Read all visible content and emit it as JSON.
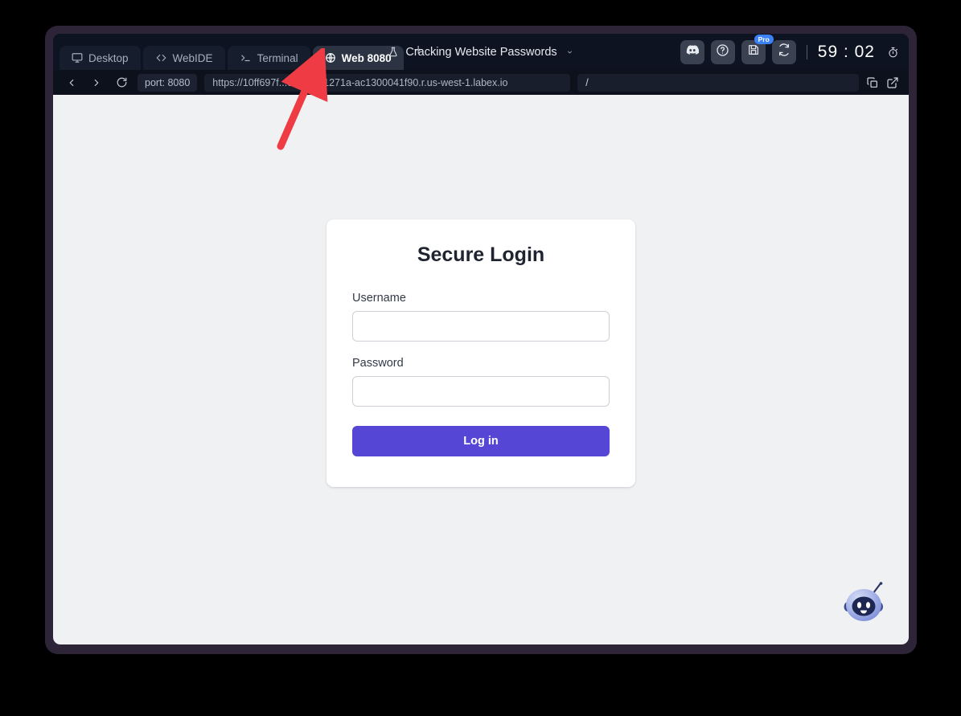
{
  "window": {
    "tabs": [
      {
        "label": "Desktop",
        "icon": "monitor-icon",
        "active": false
      },
      {
        "label": "WebIDE",
        "icon": "code-brackets-icon",
        "active": false
      },
      {
        "label": "Terminal",
        "icon": "terminal-prompt-icon",
        "active": false
      },
      {
        "label": "Web 8080",
        "icon": "globe-icon",
        "active": true
      }
    ],
    "add_tab_label": "+",
    "lab_title": "Cracking Website Passwords",
    "lab_icon": "flask-icon",
    "chevron": "⌄",
    "actions": [
      {
        "name": "discord-button",
        "icon": "discord-icon",
        "badge": null
      },
      {
        "name": "help-button",
        "icon": "question-circle-icon",
        "badge": null
      },
      {
        "name": "save-button",
        "icon": "floppy-disk-icon",
        "badge": "Pro"
      },
      {
        "name": "refresh-env-button",
        "icon": "sync-icon",
        "badge": null
      }
    ],
    "timer": "59 : 02",
    "timer_icon": "stopwatch-icon"
  },
  "browser": {
    "back_icon": "chevron-left-icon",
    "forward_icon": "chevron-right-icon",
    "reload_icon": "reload-icon",
    "port_chip": "port: 8080",
    "url": "https://10ff697f...e2ffe2f51271a-ac1300041f90.r.us-west-1.labex.io",
    "url_placeholder": "https://",
    "path": "/",
    "path_placeholder": "/",
    "copy_icon": "copy-icon",
    "open_external_icon": "external-link-icon"
  },
  "login": {
    "title": "Secure Login",
    "username_label": "Username",
    "username_value": "",
    "username_placeholder": "",
    "password_label": "Password",
    "password_value": "",
    "password_placeholder": "",
    "submit_label": "Log in"
  },
  "assistant": {
    "name": "bot-assistant-avatar"
  },
  "annotation": {
    "arrow_color": "#ef3b44",
    "points_to": "Web 8080"
  },
  "colors": {
    "accent_purple": "#5546d6",
    "pro_badge_blue": "#3b82f6",
    "page_bg": "#f0f1f3",
    "header_bg": "#0d1321",
    "frame": "#2d2537"
  }
}
